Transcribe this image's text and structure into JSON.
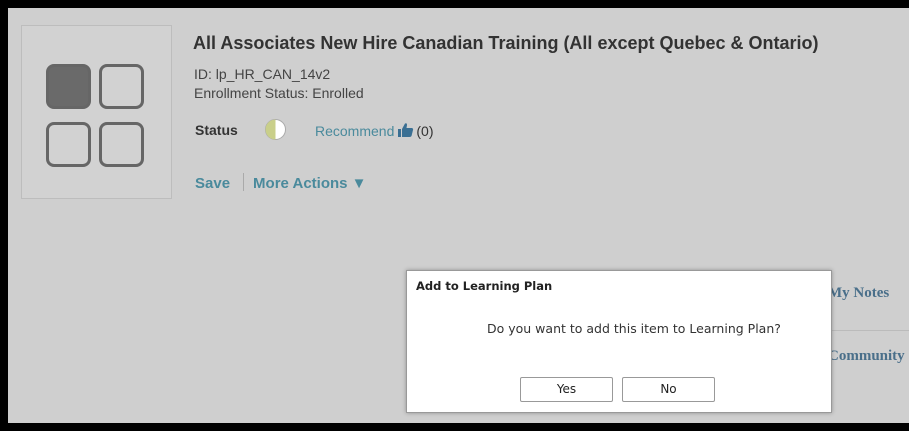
{
  "course": {
    "title": "All Associates New Hire Canadian Training (All except Quebec & Ontario)",
    "id_text": "ID: lp_HR_CAN_14v2",
    "enrollment_text": "Enrollment Status: Enrolled",
    "status_label": "Status",
    "recommend_label": "Recommend",
    "recommend_count": "(0)"
  },
  "actions": {
    "save_label": "Save",
    "more_actions_label": "More Actions ▼"
  },
  "side_panel": {
    "my_notes": "My Notes",
    "community": "Community"
  },
  "dialog": {
    "title": "Add to Learning Plan",
    "message": "Do you want to add this item to Learning Plan?",
    "yes_label": "Yes",
    "no_label": "No"
  },
  "icons": {
    "thumbnail": "grid-icon",
    "status": "half-circle-icon",
    "recommend": "thumbs-up-icon"
  },
  "colors": {
    "link": "#4a8a9c",
    "background": "#cfcfcf",
    "status_fill": "#c9cf8a"
  }
}
